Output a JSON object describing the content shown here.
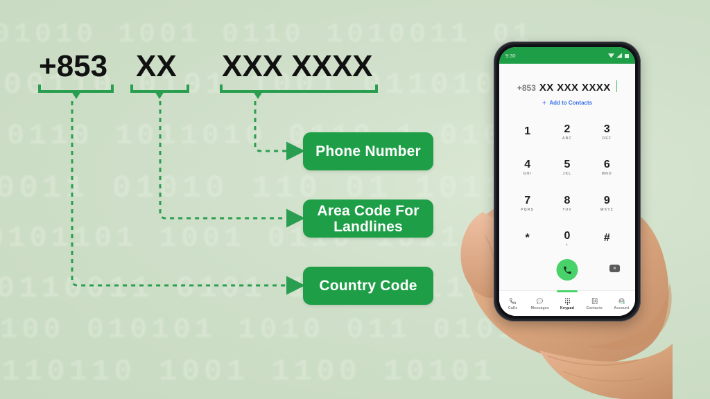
{
  "colors": {
    "background": "#cfdfc9",
    "accent_green": "#1e9e47",
    "bracket_green": "#2a9e50",
    "label_text": "#ffffff",
    "call_button": "#4ad26a",
    "link_blue": "#3b74e8"
  },
  "format": {
    "segments": [
      {
        "text": "+853",
        "label_ref": "Country Code"
      },
      {
        "text": "XX",
        "label_ref": "Area Code For Landlines"
      },
      {
        "text": "XXX XXXX",
        "label_ref": "Phone Number"
      }
    ]
  },
  "labels": [
    {
      "id": "phone-number",
      "text": "Phone Number"
    },
    {
      "id": "area-code",
      "text": "Area Code For\nLandlines"
    },
    {
      "id": "country-code",
      "text": "Country Code"
    }
  ],
  "label_lines": {
    "phone_number": "Phone Number",
    "area_code_line1": "Area Code For",
    "area_code_line2": "Landlines",
    "country_code": "Country Code"
  },
  "phone": {
    "status_bar": {
      "time": "9:30",
      "icons": [
        "wifi-icon",
        "signal-icon",
        "battery-icon"
      ]
    },
    "dialer": {
      "country_code": "+853",
      "number": "XX XXX XXXX",
      "add_contacts_label": "Add to Contacts",
      "add_contacts_icon": "plus-icon"
    },
    "keypad": [
      {
        "digit": "1",
        "letters": ""
      },
      {
        "digit": "2",
        "letters": "ABC"
      },
      {
        "digit": "3",
        "letters": "DEF"
      },
      {
        "digit": "4",
        "letters": "GHI"
      },
      {
        "digit": "5",
        "letters": "JKL"
      },
      {
        "digit": "6",
        "letters": "MNO"
      },
      {
        "digit": "7",
        "letters": "PQRS"
      },
      {
        "digit": "8",
        "letters": "TUV"
      },
      {
        "digit": "9",
        "letters": "WXYZ"
      },
      {
        "digit": "*",
        "letters": ""
      },
      {
        "digit": "0",
        "letters": "+"
      },
      {
        "digit": "#",
        "letters": ""
      }
    ],
    "actions": {
      "call_icon": "phone-handset-icon",
      "backspace_icon": "backspace-icon"
    },
    "nav": [
      {
        "label": "Calls",
        "icon": "calls-icon",
        "active": false
      },
      {
        "label": "Messages",
        "icon": "messages-icon",
        "active": false
      },
      {
        "label": "Keypad",
        "icon": "keypad-icon",
        "active": true
      },
      {
        "label": "Contacts",
        "icon": "contacts-icon",
        "active": false
      },
      {
        "label": "Account",
        "icon": "account-avatar-icon",
        "active": false
      }
    ]
  },
  "background_watermark": [
    "01010 1001 0110 1010011 01",
    "1100110 0101 1001 011010",
    "0110 1011010 0110 1 0101",
    "10011 01010 110 01 10110",
    "0101101 1001 0110 101101",
    "1 0110011 0101 1001 0110",
    "100 010101 1010 011 0101",
    "0110110 1001 1100 10101"
  ]
}
